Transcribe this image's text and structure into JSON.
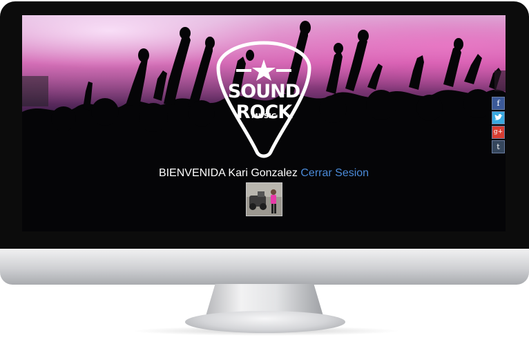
{
  "brand": {
    "name": "SOUND ROCK",
    "tagline": "MUSIC"
  },
  "session": {
    "greeting": "BIENVENIDA Kari Gonzalez",
    "logout_label": "Cerrar Sesion"
  },
  "social": [
    {
      "name": "facebook",
      "glyph": "f",
      "color": "#3b5998"
    },
    {
      "name": "twitter",
      "glyph": "🐦",
      "color": "#39a9e0"
    },
    {
      "name": "google-plus",
      "glyph": "g+",
      "color": "#d73d32"
    },
    {
      "name": "tumblr",
      "glyph": "t",
      "color": "#35465c"
    }
  ],
  "colors": {
    "link": "#4a8ad8",
    "bezel": "#0c0c0c"
  }
}
